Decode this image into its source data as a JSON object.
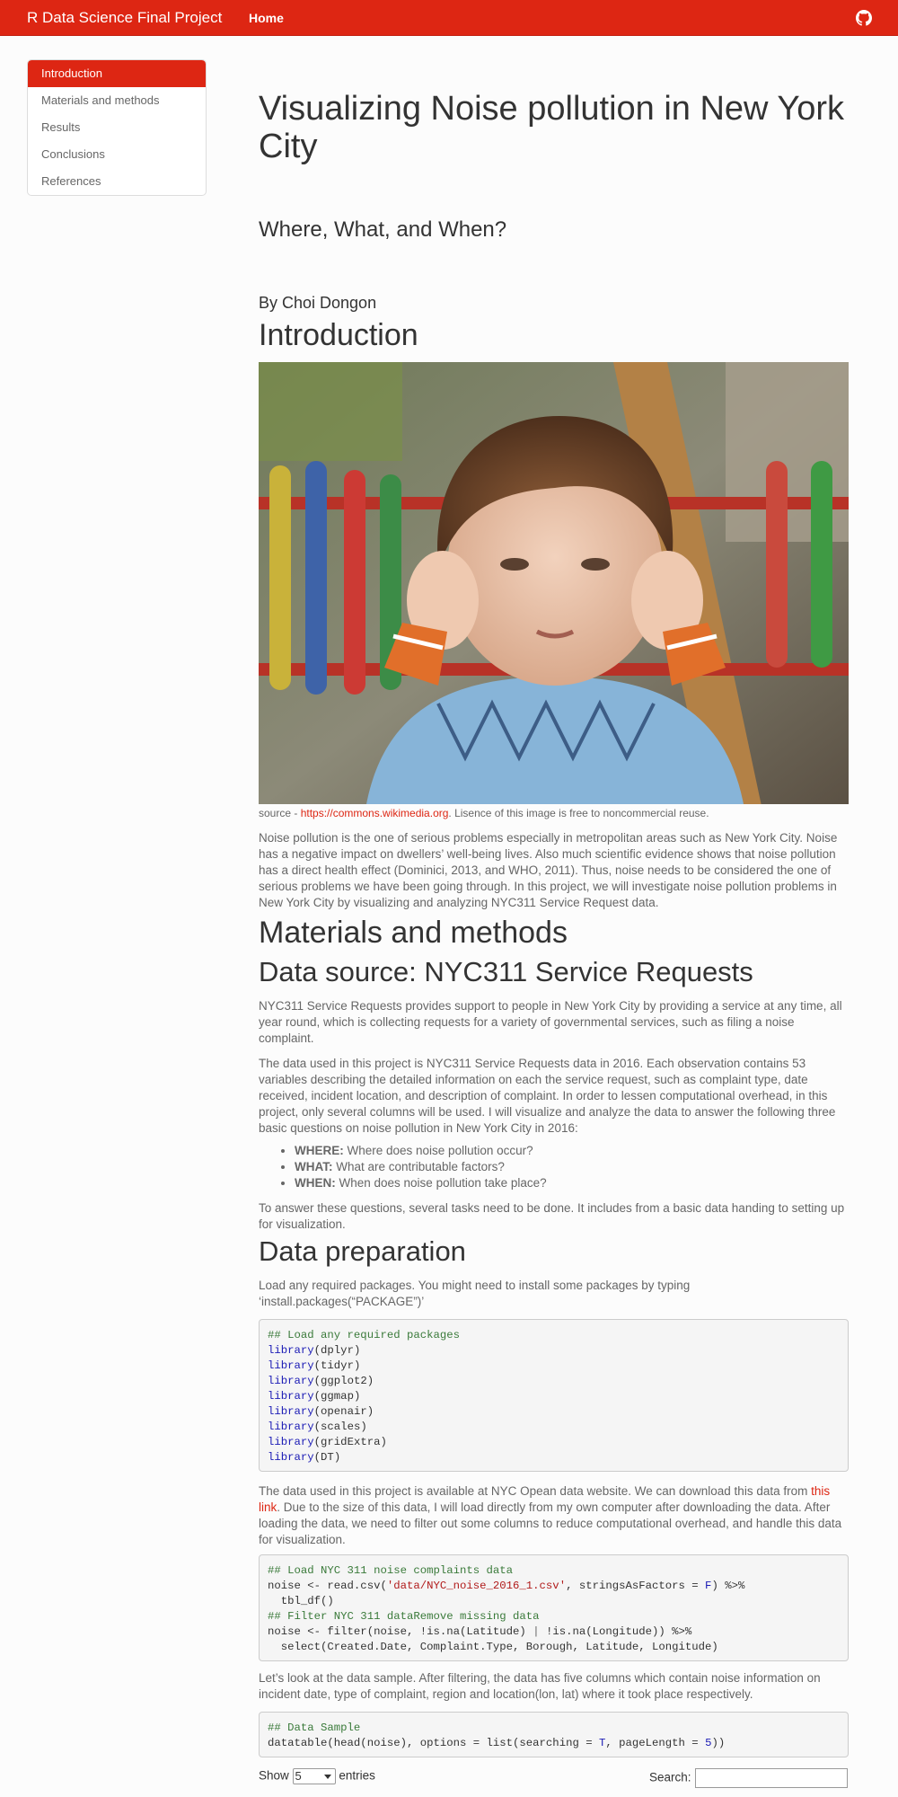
{
  "navbar": {
    "brand": "R Data Science Final Project",
    "home": "Home",
    "github_icon": "github-icon"
  },
  "toc": {
    "items": [
      "Introduction",
      "Materials and methods",
      "Results",
      "Conclusions",
      "References"
    ]
  },
  "header": {
    "title": "Visualizing Noise pollution in New York City",
    "subtitle": "Where, What, and When?",
    "author": "By Choi Dongon"
  },
  "intro": {
    "heading": "Introduction",
    "caption_prefix": "source - ",
    "caption_link": "https://commons.wikimedia.org",
    "caption_suffix": ". Lisence of this image is free to noncommercial reuse.",
    "paragraph": "Noise pollution is the one of serious problems especially in metropolitan areas such as New York City. Noise has a negative impact on dwellers’ well-being lives. Also much scientific evidence shows that noise pollution has a direct health effect (Dominici, 2013, and WHO, 2011). Thus, noise needs to be considered the one of serious problems we have been going through. In this project, we will investigate noise pollution problems in New York City by visualizing and analyzing NYC311 Service Request data."
  },
  "methods": {
    "heading": "Materials and methods",
    "source_heading": "Data source: NYC311 Service Requests",
    "p1": "NYC311 Service Requests provides support to people in New York City by providing a service at any time, all year round, which is collecting requests for a variety of governmental services, such as filing a noise complaint.",
    "p2": "The data used in this project is NYC311 Service Requests data in 2016. Each observation contains 53 variables describing the detailed information on each the service request, such as complaint type, date received, incident location, and description of complaint. In order to lessen computational overhead, in this project, only several columns will be used. I will visualize and analyze the data to answer the following three basic questions on noise pollution in New York City in 2016:",
    "questions": [
      {
        "label": "WHERE:",
        "text": " Where does noise pollution occur?"
      },
      {
        "label": "WHAT:",
        "text": " What are contributable factors?"
      },
      {
        "label": "WHEN:",
        "text": " When does noise pollution take place?"
      }
    ],
    "p3": "To answer these questions, several tasks need to be done. It includes from a basic data handing to setting up for visualization."
  },
  "prep": {
    "heading": "Data preparation",
    "p1_line1": "Load any required packages. You might need to install some packages by typing",
    "p1_line2": "‘install.packages(“PACKAGE”)’",
    "code1_comment": "## Load any required packages",
    "code1_fn": "library",
    "code1_libs": [
      "dplyr",
      "tidyr",
      "ggplot2",
      "ggmap",
      "openair",
      "scales",
      "gridExtra",
      "DT"
    ],
    "p2_before": "The data used in this project is available at NYC Opean data website. We can download this data from ",
    "p2_link": "this link",
    "p2_after": ". Due to the size of this data, I will load directly from my own computer after downloading the data. After loading the data, we need to filter out some columns to reduce computational overhead, and handle this data for visualization.",
    "code2": {
      "c1": "## Load NYC 311 noise complaints data",
      "l1a": "noise <- read.csv(",
      "l1s": "'data/NYC_noise_2016_1.csv'",
      "l1b": ", stringsAsFactors = ",
      "l1f": "F",
      "l1c": ") %>%",
      "l2": "  tbl_df()",
      "c2": "## Filter NYC 311 dataRemove missing data",
      "l3a": "noise <- filter(noise, !is.na(Latitude) ",
      "l3p": "|",
      "l3b": " !is.na(Longitude)) %>%",
      "l4": "  select(Created.Date, Complaint.Type, Borough, Latitude, Longitude)"
    },
    "p3": "Let’s look at the data sample. After filtering, the data has five columns which contain noise information on incident date, type of complaint, region and location(lon, lat) where it took place respectively.",
    "code3": {
      "c1": "## Data Sample",
      "l1a": "datatable(head(noise), options = list(searching = ",
      "l1t": "T",
      "l1b": ", pageLength = ",
      "l1n": "5",
      "l1c": "))"
    }
  },
  "datatable": {
    "show": "Show",
    "length_value": "5",
    "entries": "entries",
    "search": "Search:"
  }
}
